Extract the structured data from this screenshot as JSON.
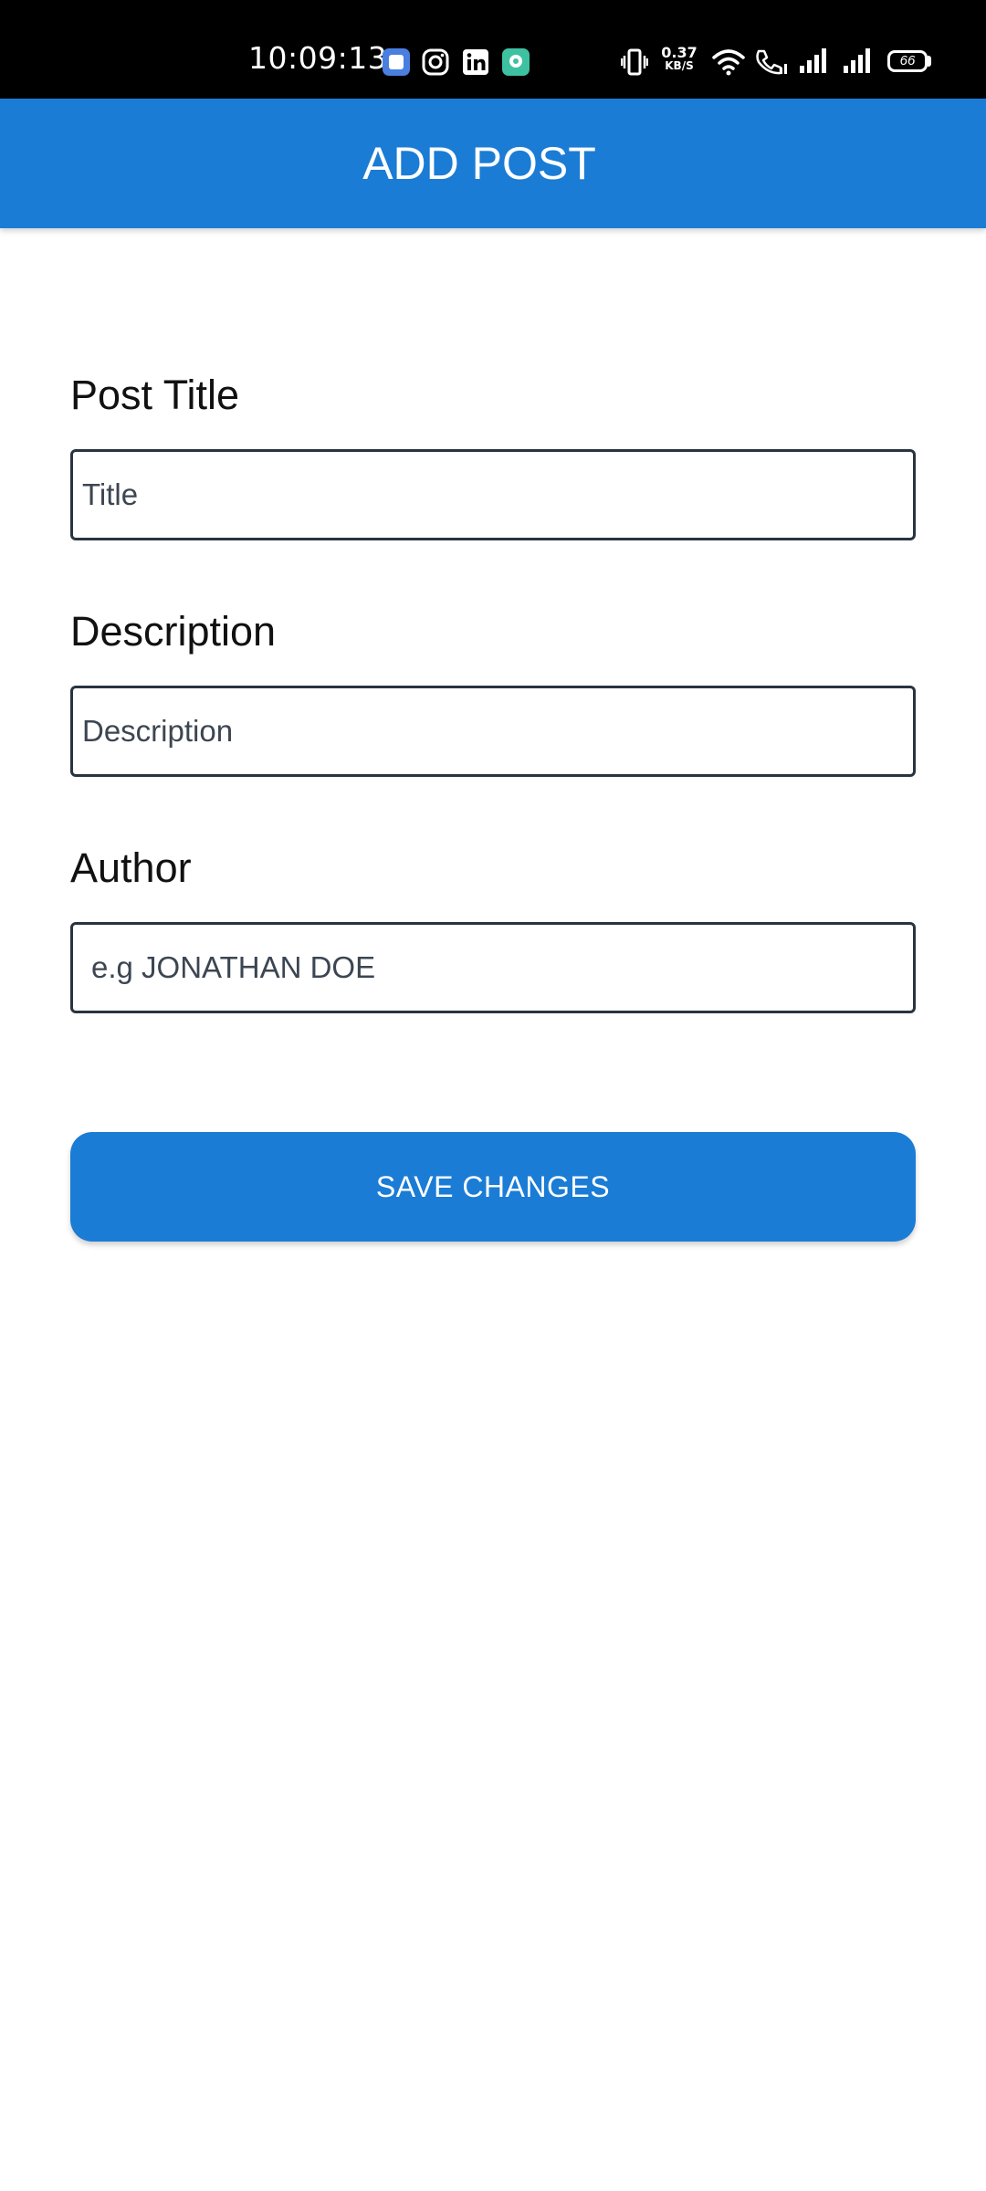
{
  "status_bar": {
    "time": "10:09:13",
    "net_speed_value": "0.37",
    "net_speed_unit": "KB/S",
    "battery_level": "66",
    "notification_icons": [
      "app-icon",
      "instagram-icon",
      "linkedin-icon",
      "chat-app-icon"
    ]
  },
  "app_bar": {
    "title": "ADD POST",
    "color": "#1a7cd5"
  },
  "form": {
    "title_label": "Post Title",
    "title_placeholder": "Title",
    "description_label": "Description",
    "description_placeholder": "Description",
    "author_label": "Author",
    "author_placeholder": "e.g JONATHAN DOE",
    "save_label": "SAVE CHANGES"
  }
}
